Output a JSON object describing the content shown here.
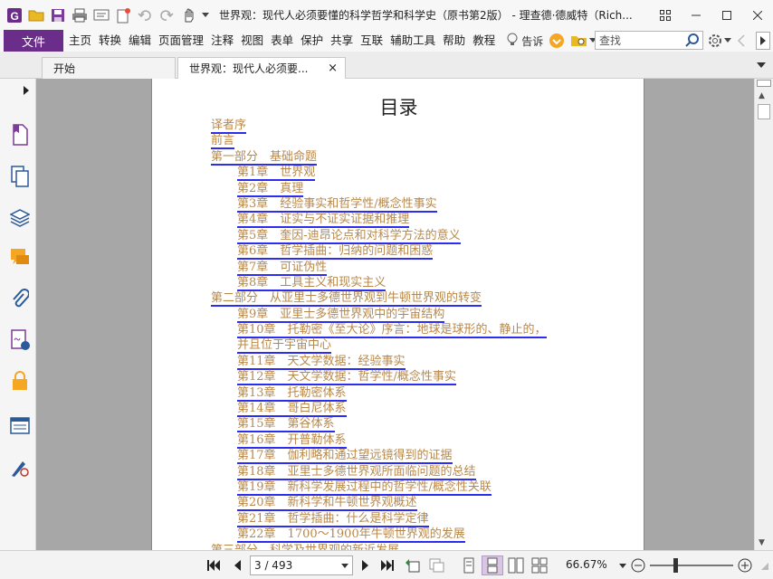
{
  "window": {
    "title": "世界观：现代人必须要懂的科学哲学和科学史（原书第2版） - 理查德·德威特（Rich...",
    "colors": {
      "brand": "#6b2d8a",
      "link_text": "#b8884a",
      "link_underline": "#2d2df0",
      "doc_bg": "#a7a7a7"
    }
  },
  "menu": {
    "file": "文件",
    "items": [
      "主页",
      "转换",
      "编辑",
      "页面管理",
      "注释",
      "视图",
      "表单",
      "保护",
      "共享",
      "互联",
      "辅助工具",
      "帮助",
      "教程"
    ],
    "tell_me": "告诉",
    "search_placeholder": "查找"
  },
  "tabs": [
    {
      "label": "开始"
    },
    {
      "label": "世界观：现代人必须要...",
      "close": "×"
    }
  ],
  "document": {
    "toc_title": "目录",
    "toc": [
      {
        "text": "译者序",
        "level": 1
      },
      {
        "text": "前言",
        "level": 1
      },
      {
        "text": "第一部分　基础命题",
        "level": 1
      },
      {
        "text": "第1章　世界观",
        "level": 2
      },
      {
        "text": "第2章　真理",
        "level": 2
      },
      {
        "text": "第3章　经验事实和哲学性/概念性事实",
        "level": 2
      },
      {
        "text": "第4章　证实与不证实证据和推理",
        "level": 2
      },
      {
        "text": "第5章　奎因-迪昂论点和对科学方法的意义",
        "level": 2
      },
      {
        "text": "第6章　哲学插曲：归纳的问题和困惑",
        "level": 2
      },
      {
        "text": "第7章　可证伪性",
        "level": 2
      },
      {
        "text": "第8章　工具主义和现实主义",
        "level": 2
      },
      {
        "text": "第二部分　从亚里士多德世界观到牛顿世界观的转变",
        "level": 1
      },
      {
        "text": "第9章　亚里士多德世界观中的宇宙结构",
        "level": 2
      },
      {
        "text": "第10章　托勒密《至大论》序言：地球是球形的、静止的，",
        "level": 2
      },
      {
        "text": "并且位于宇宙中心",
        "level": 2
      },
      {
        "text": "第11章　天文学数据：经验事实",
        "level": 2
      },
      {
        "text": "第12章　天文学数据：哲学性/概念性事实",
        "level": 2
      },
      {
        "text": "第13章　托勒密体系",
        "level": 2
      },
      {
        "text": "第14章　哥白尼体系",
        "level": 2
      },
      {
        "text": "第15章　第谷体系",
        "level": 2
      },
      {
        "text": "第16章　开普勒体系",
        "level": 2
      },
      {
        "text": "第17章　伽利略和通过望远镜得到的证据",
        "level": 2
      },
      {
        "text": "第18章　亚里士多德世界观所面临问题的总结",
        "level": 2
      },
      {
        "text": "第19章　新科学发展过程中的哲学性/概念性关联",
        "level": 2
      },
      {
        "text": "第20章　新科学和牛顿世界观概述",
        "level": 2
      },
      {
        "text": "第21章　哲学插曲：什么是科学定律",
        "level": 2
      },
      {
        "text": "第22章　1700～1900年牛顿世界观的发展",
        "level": 2
      },
      {
        "text": "第三部分　科学及世界观的新近发展",
        "level": 1
      }
    ]
  },
  "status": {
    "page_display": "3 / 493",
    "zoom": "66.67%",
    "zoom_level_fraction": 0.3
  }
}
